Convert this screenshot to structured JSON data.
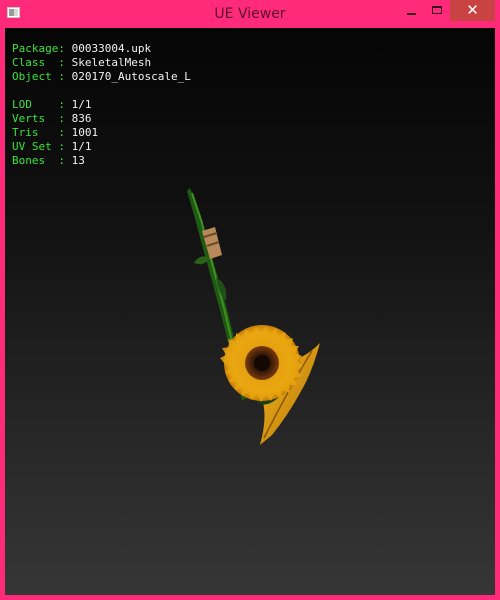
{
  "window": {
    "title": "UE Viewer",
    "controls": {
      "minimize": "",
      "maximize": "",
      "close": "✕"
    }
  },
  "info": [
    {
      "key": "Package:",
      "value": "00033004.upk"
    },
    {
      "key": "Class  :",
      "value": "SkeletalMesh"
    },
    {
      "key": "Object :",
      "value": "020170_Autoscale_L"
    },
    {
      "key": "LOD    :",
      "value": "1/1"
    },
    {
      "key": "Verts  :",
      "value": "836"
    },
    {
      "key": "Tris   :",
      "value": "1001"
    },
    {
      "key": "UV Set :",
      "value": "1/1"
    },
    {
      "key": "Bones  :",
      "value": "13"
    }
  ],
  "colors": {
    "frame": "#ff2a7a",
    "label": "#3de33d",
    "value": "#f2f2f2",
    "close_button": "#c94343"
  }
}
